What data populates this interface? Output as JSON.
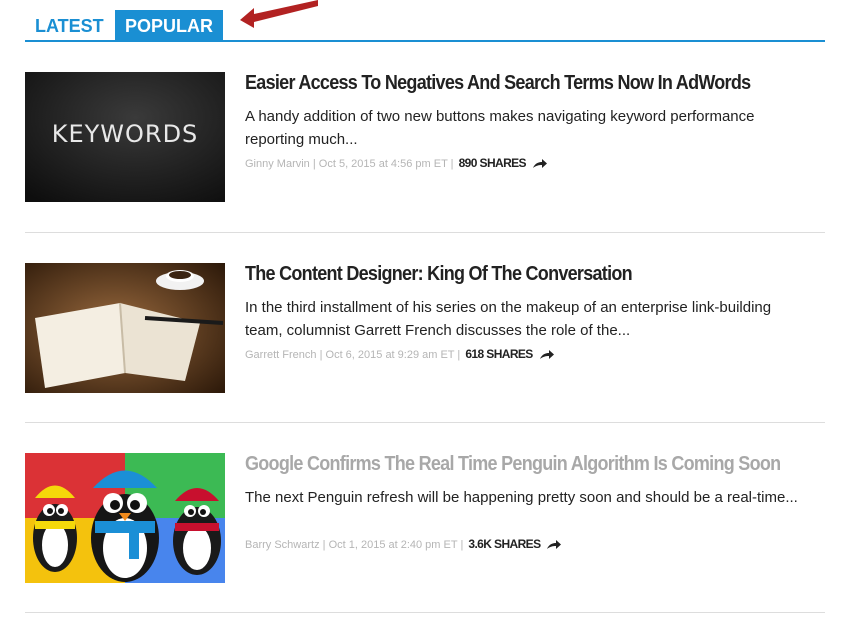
{
  "tabs": {
    "latest": "LATEST",
    "popular": "POPULAR"
  },
  "annotation_arrow_color": "#b22222",
  "accent_color": "#1a8fd3",
  "articles": [
    {
      "title": "Easier Access To Negatives And Search Terms Now In AdWords",
      "excerpt": "A handy addition of two new buttons makes navigating keyword performance reporting much...",
      "author": "Ginny Marvin",
      "date": "Oct 5, 2015 at 4:56 pm ET",
      "shares": "890 SHARES",
      "image": "chalkboard-keywords",
      "image_text": "KEYWORDS",
      "title_muted": false
    },
    {
      "title": "The Content Designer: King Of The Conversation",
      "excerpt": "In the third installment of his series on the makeup of an enterprise link-building team, columnist Garrett French discusses the role of the...",
      "author": "Garrett French",
      "date": "Oct 6, 2015 at 9:29 am ET",
      "shares": "618 SHARES",
      "image": "open-notebook-coffee",
      "title_muted": false
    },
    {
      "title": "Google Confirms The Real Time Penguin Algorithm Is Coming Soon",
      "excerpt": "The next Penguin refresh will be happening pretty soon and should be a real-time...",
      "author": "Barry Schwartz",
      "date": "Oct 1, 2015 at 2:40 pm ET",
      "shares": "3.6K SHARES",
      "image": "penguins-google-colors",
      "title_muted": true
    }
  ]
}
